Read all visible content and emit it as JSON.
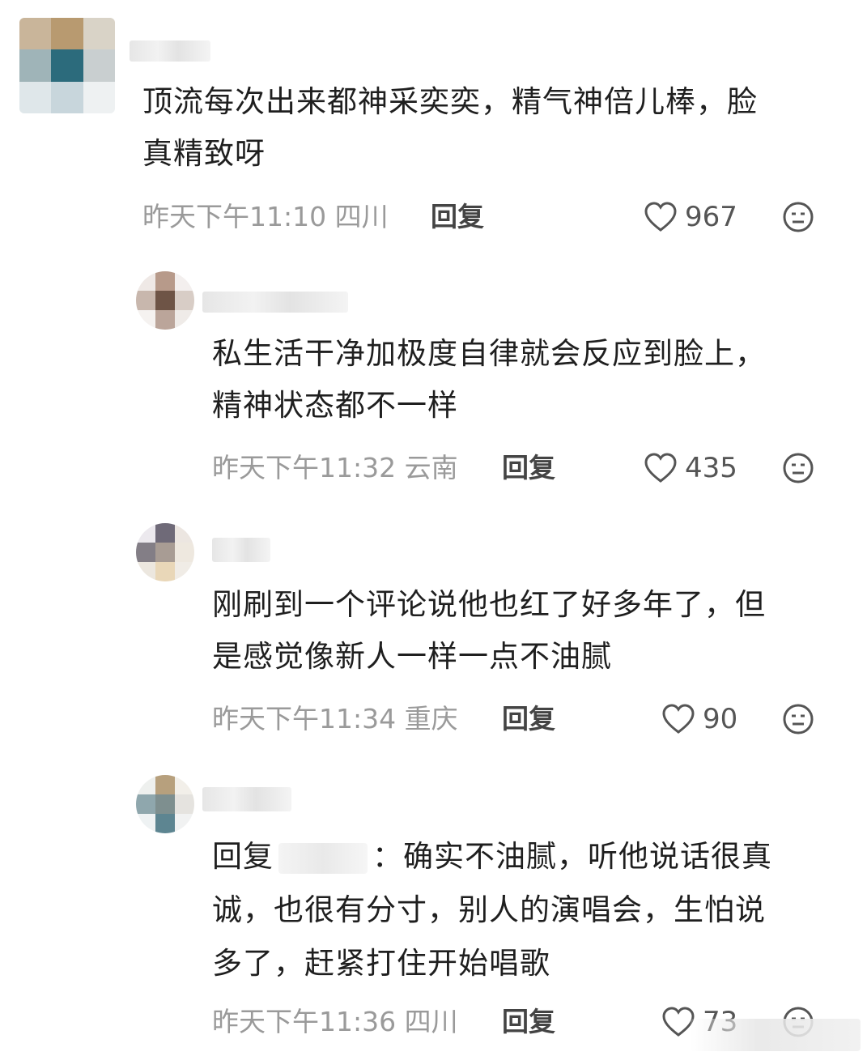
{
  "comments": [
    {
      "text_lines": [
        "顶流每次出来都神采奕奕，精气神倍儿棒，脸",
        "真精致呀"
      ],
      "time_location": "昨天下午11:10 四川",
      "reply_label": "回复",
      "likes": "967"
    },
    {
      "text_lines": [
        "私生活干净加极度自律就会反应到脸上，",
        "精神状态都不一样"
      ],
      "time_location": "昨天下午11:32 云南",
      "reply_label": "回复",
      "likes": "435"
    },
    {
      "text_lines": [
        "刚刷到一个评论说他也红了好多年了，但",
        "是感觉像新人一样一点不油腻"
      ],
      "time_location": "昨天下午11:34 重庆",
      "reply_label": "回复",
      "likes": "90"
    },
    {
      "reply_prefix": "回复",
      "text_first_tail": "：确实不油腻，听他说话很真",
      "text_lines_rest": [
        "诚，也很有分寸，别人的演唱会，生怕说",
        "多了，赶紧打住开始唱歌"
      ],
      "time_location": "昨天下午11:36 四川",
      "reply_label": "回复",
      "likes": "73"
    }
  ],
  "icons": {
    "like": "heart-outline-icon",
    "dislike": "neutral-face-icon"
  },
  "colors": {
    "text": "#1f1f1f",
    "meta": "#9a9a9a",
    "reply": "#444444"
  }
}
